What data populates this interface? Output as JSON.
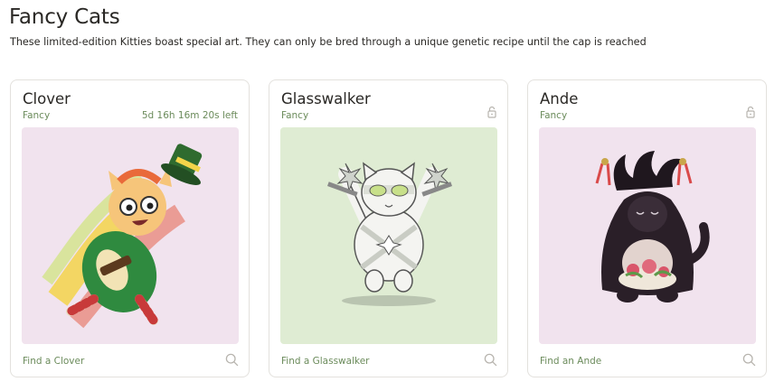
{
  "page": {
    "title": "Fancy Cats",
    "subtitle": "These limited-edition Kitties boast special art. They can only be bred through a unique genetic recipe until the cap is reached"
  },
  "cards": [
    {
      "name": "Clover",
      "kind": "Fancy",
      "timer": "5d 16h 16m 20s left",
      "find_label": "Find a Clover",
      "art_background": "#f1e3ee",
      "status_icon": null
    },
    {
      "name": "Glasswalker",
      "kind": "Fancy",
      "timer": null,
      "find_label": "Find a Glasswalker",
      "art_background": "#dfecd3",
      "status_icon": "unlock-icon"
    },
    {
      "name": "Ande",
      "kind": "Fancy",
      "timer": null,
      "find_label": "Find an Ande",
      "art_background": "#f1e3ee",
      "status_icon": "unlock-icon"
    }
  ],
  "colors": {
    "text": "#2a2825",
    "accent_green": "#6b8b5b",
    "card_border": "#e3e1dd",
    "icon_gray": "#b7b4ae"
  }
}
